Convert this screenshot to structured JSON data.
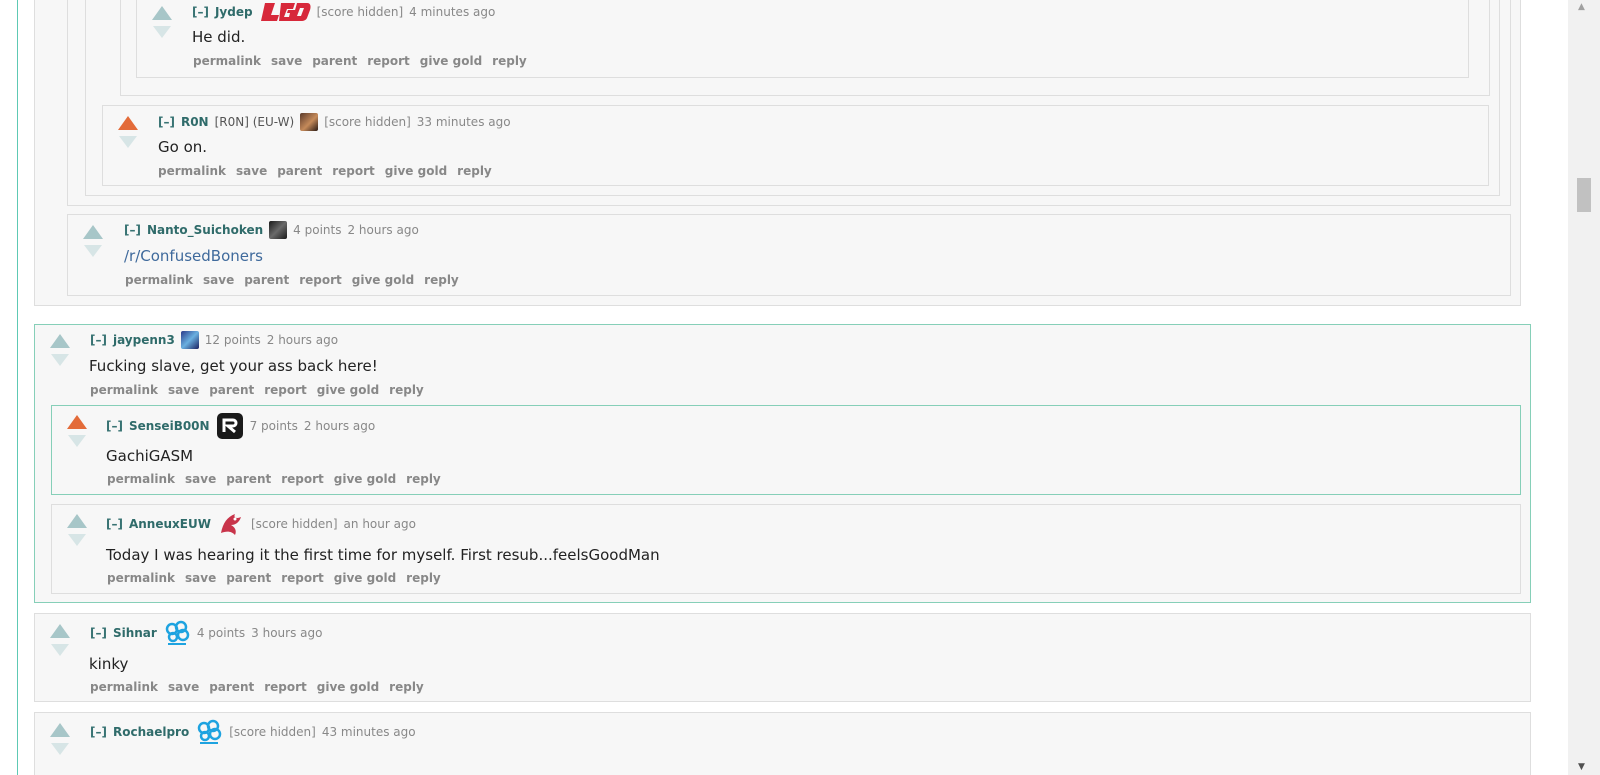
{
  "colors": {
    "accent": "#5ec9b4",
    "upvoted": "#e36b39",
    "author": "#2f6b6a",
    "link": "#3f6a9c"
  },
  "actions": [
    "permalink",
    "save",
    "parent",
    "report",
    "give gold",
    "reply"
  ],
  "comments": [
    {
      "collapse": "[–]",
      "author": "Jydep",
      "flair_text": "",
      "flair_icon": "lgd-logo-icon",
      "score": "[score hidden]",
      "time": "4 minutes ago",
      "body": "He did."
    },
    {
      "collapse": "[–]",
      "author": "R0N",
      "flair_text": "[R0N] (EU-W)",
      "flair_icon": "champion-portrait-icon",
      "score": "[score hidden]",
      "time": "33 minutes ago",
      "body": "Go on."
    },
    {
      "collapse": "[–]",
      "author": "Nanto_Suichoken",
      "flair_text": "",
      "flair_icon": "champion-portrait-icon",
      "score": "4 points",
      "time": "2 hours ago",
      "body": "/r/ConfusedBoners"
    },
    {
      "collapse": "[–]",
      "author": "jaypenn3",
      "flair_text": "",
      "flair_icon": "champion-portrait-icon",
      "score": "12 points",
      "time": "2 hours ago",
      "body": "Fucking slave, get your ass back here!"
    },
    {
      "collapse": "[–]",
      "author": "SenseiB00N",
      "flair_text": "",
      "flair_icon": "team-logo-icon",
      "score": "7 points",
      "time": "2 hours ago",
      "body": "GachiGASM"
    },
    {
      "collapse": "[–]",
      "author": "AnneuxEUW",
      "flair_text": "",
      "flair_icon": "team-logo-icon",
      "score": "[score hidden]",
      "time": "an hour ago",
      "body": "Today I was hearing it the first time for myself. First resub...feelsGoodMan"
    },
    {
      "collapse": "[–]",
      "author": "Sihnar",
      "flair_text": "",
      "flair_icon": "cloud9-logo-icon",
      "score": "4 points",
      "time": "3 hours ago",
      "body": "kinky"
    },
    {
      "collapse": "[–]",
      "author": "Rochaelpro",
      "flair_text": "",
      "flair_icon": "cloud9-logo-icon",
      "score": "[score hidden]",
      "time": "43 minutes ago",
      "body": ""
    }
  ],
  "scrollbar": {
    "up_arrow": "▲",
    "down_arrow": "▼"
  }
}
